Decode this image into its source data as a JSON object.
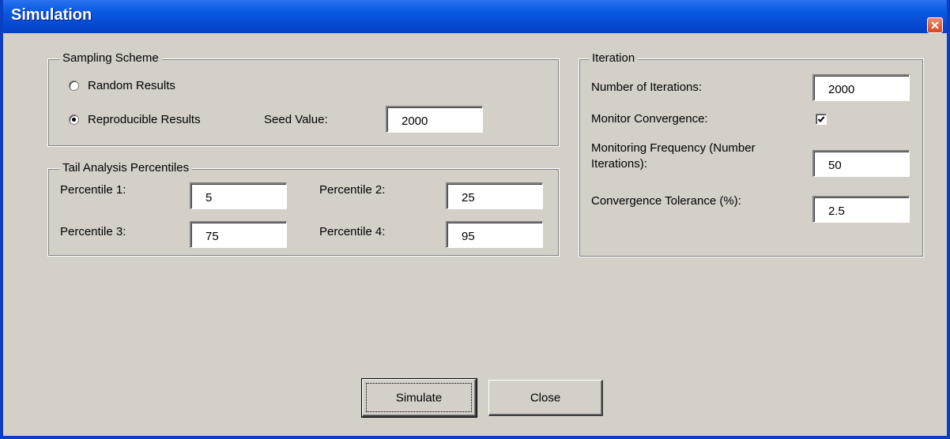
{
  "window": {
    "title": "Simulation"
  },
  "sampling": {
    "legend": "Sampling Scheme",
    "random_label": "Random Results",
    "reproducible_label": "Reproducible Results",
    "selected": "reproducible",
    "seed_label": "Seed Value:",
    "seed_value": "2000"
  },
  "tail": {
    "legend": "Tail Analysis Percentiles",
    "p1_label": "Percentile 1:",
    "p1_value": "5",
    "p2_label": "Percentile 2:",
    "p2_value": "25",
    "p3_label": "Percentile 3:",
    "p3_value": "75",
    "p4_label": "Percentile 4:",
    "p4_value": "95"
  },
  "iteration": {
    "legend": "Iteration",
    "num_label": "Number of Iterations:",
    "num_value": "2000",
    "monitor_label": "Monitor Convergence:",
    "monitor_checked": true,
    "freq_label_line1": "Monitoring Frequency (Number",
    "freq_label_line2": "Iterations):",
    "freq_value": "50",
    "tol_label": "Convergence Tolerance (%):",
    "tol_value": "2.5"
  },
  "buttons": {
    "simulate": "Simulate",
    "close": "Close"
  },
  "colors": {
    "titlebar": "#0a5ae2",
    "face": "#d4d0c8",
    "close_button": "#d9421c"
  },
  "icons": {
    "close": "close-icon",
    "check": "check-icon"
  }
}
